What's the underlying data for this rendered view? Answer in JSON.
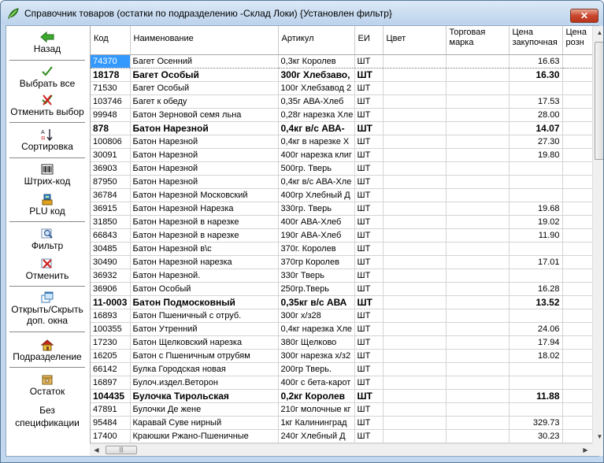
{
  "window": {
    "title": "Справочник товаров (остатки по подразделению -Склад Локи) {Установлен фильтр}",
    "close_label": "✕"
  },
  "sidebar": {
    "back": "Назад",
    "select_all": "Выбрать все",
    "cancel_selection": "Отменить выбор",
    "sort": "Сортировка",
    "barcode": "Штрих-код",
    "plu": "PLU код",
    "filter": "Фильтр",
    "cancel": "Отменить",
    "toggle_windows": "Открыть/Скрыть доп. окна",
    "department": "Подразделение",
    "remainder": "Остаток",
    "no_spec": "Без спецификации"
  },
  "table": {
    "headers": [
      "Код",
      "Наименование",
      "Артикул",
      "ЕИ",
      "Цвет",
      "Торговая марка",
      "Цена закупочная",
      "Цена розн"
    ],
    "rows": [
      {
        "code": "74370",
        "name": "Багет Осенний",
        "article": "0,3кг Королев",
        "unit": "ШТ",
        "color": "",
        "brand": "",
        "price": "16.63",
        "retail": "",
        "bold": false,
        "selected": true
      },
      {
        "code": "18178",
        "name": "Багет Особый",
        "article": "300г Хлебзаво,",
        "unit": "ШТ",
        "color": "",
        "brand": "",
        "price": "16.30",
        "retail": "",
        "bold": true,
        "selected": false
      },
      {
        "code": "71530",
        "name": "Багет Особый",
        "article": "100г Хлебзавод 2",
        "unit": "ШТ",
        "color": "",
        "brand": "",
        "price": "",
        "retail": "",
        "bold": false,
        "selected": false
      },
      {
        "code": "103746",
        "name": "Багет к обеду",
        "article": "0,35г АВА-Хлеб",
        "unit": "ШТ",
        "color": "",
        "brand": "",
        "price": "17.53",
        "retail": "",
        "bold": false,
        "selected": false
      },
      {
        "code": "99948",
        "name": "Батон Зерновой семя льна",
        "article": "0,28г нарезка Хле",
        "unit": "ШТ",
        "color": "",
        "brand": "",
        "price": "28.00",
        "retail": "",
        "bold": false,
        "selected": false
      },
      {
        "code": "878",
        "name": "Батон Нарезной",
        "article": "0,4кг в/с АВА-",
        "unit": "ШТ",
        "color": "",
        "brand": "",
        "price": "14.07",
        "retail": "",
        "bold": true,
        "selected": false
      },
      {
        "code": "100806",
        "name": "Батон Нарезной",
        "article": "0,4кг в нарезке Х",
        "unit": "ШТ",
        "color": "",
        "brand": "",
        "price": "27.30",
        "retail": "",
        "bold": false,
        "selected": false
      },
      {
        "code": "30091",
        "name": "Батон Нарезной",
        "article": "400г нарезка клиг",
        "unit": "ШТ",
        "color": "",
        "brand": "",
        "price": "19.80",
        "retail": "",
        "bold": false,
        "selected": false
      },
      {
        "code": "36903",
        "name": "Батон Нарезной",
        "article": "500гр. Тверь",
        "unit": "ШТ",
        "color": "",
        "brand": "",
        "price": "",
        "retail": "",
        "bold": false,
        "selected": false
      },
      {
        "code": "87950",
        "name": "Батон Нарезной",
        "article": "0,4кг в/с АВА-Хле",
        "unit": "ШТ",
        "color": "",
        "brand": "",
        "price": "",
        "retail": "",
        "bold": false,
        "selected": false
      },
      {
        "code": "36784",
        "name": "Батон Нарезной Московский",
        "article": "400гр Хлебный Д",
        "unit": "ШТ",
        "color": "",
        "brand": "",
        "price": "",
        "retail": "",
        "bold": false,
        "selected": false
      },
      {
        "code": "36915",
        "name": "Батон Нарезной Нарезка",
        "article": "330гр. Тверь",
        "unit": "ШТ",
        "color": "",
        "brand": "",
        "price": "19.68",
        "retail": "",
        "bold": false,
        "selected": false
      },
      {
        "code": "31850",
        "name": "Батон Нарезной в нарезке",
        "article": "400г АВА-Хлеб",
        "unit": "ШТ",
        "color": "",
        "brand": "",
        "price": "19.02",
        "retail": "",
        "bold": false,
        "selected": false
      },
      {
        "code": "66843",
        "name": "Батон Нарезной в нарезке",
        "article": "190г АВА-Хлеб",
        "unit": "ШТ",
        "color": "",
        "brand": "",
        "price": "11.90",
        "retail": "",
        "bold": false,
        "selected": false
      },
      {
        "code": "30485",
        "name": "Батон Нарезной в\\с",
        "article": "370г. Королев",
        "unit": "ШТ",
        "color": "",
        "brand": "",
        "price": "",
        "retail": "",
        "bold": false,
        "selected": false
      },
      {
        "code": "30490",
        "name": "Батон Нарезной нарезка",
        "article": "370гр Королев",
        "unit": "ШТ",
        "color": "",
        "brand": "",
        "price": "17.01",
        "retail": "",
        "bold": false,
        "selected": false
      },
      {
        "code": "36932",
        "name": "Батон Нарезной.",
        "article": "330г Тверь",
        "unit": "ШТ",
        "color": "",
        "brand": "",
        "price": "",
        "retail": "",
        "bold": false,
        "selected": false
      },
      {
        "code": "36906",
        "name": "Батон Особый",
        "article": "250гр.Тверь",
        "unit": "ШТ",
        "color": "",
        "brand": "",
        "price": "16.28",
        "retail": "",
        "bold": false,
        "selected": false
      },
      {
        "code": "11-0003",
        "name": "Батон Подмосковный",
        "article": "0,35кг в/с АВА",
        "unit": "ШТ",
        "color": "",
        "brand": "",
        "price": "13.52",
        "retail": "",
        "bold": true,
        "selected": false
      },
      {
        "code": "16893",
        "name": "Батон Пшеничный с отруб.",
        "article": "300г х/з28",
        "unit": "ШТ",
        "color": "",
        "brand": "",
        "price": "",
        "retail": "",
        "bold": false,
        "selected": false
      },
      {
        "code": "100355",
        "name": "Батон Утренний",
        "article": "0,4кг нарезка Хле",
        "unit": "ШТ",
        "color": "",
        "brand": "",
        "price": "24.06",
        "retail": "",
        "bold": false,
        "selected": false
      },
      {
        "code": "17230",
        "name": "Батон Щелковский нарезка",
        "article": "380г Щелково",
        "unit": "ШТ",
        "color": "",
        "brand": "",
        "price": "17.94",
        "retail": "",
        "bold": false,
        "selected": false
      },
      {
        "code": "16205",
        "name": "Батон с Пшеничным отрубям",
        "article": "300г нарезка х/з2",
        "unit": "ШТ",
        "color": "",
        "brand": "",
        "price": "18.02",
        "retail": "",
        "bold": false,
        "selected": false
      },
      {
        "code": "66142",
        "name": "Булка Городская новая",
        "article": "200гр Тверь.",
        "unit": "ШТ",
        "color": "",
        "brand": "",
        "price": "",
        "retail": "",
        "bold": false,
        "selected": false
      },
      {
        "code": "16897",
        "name": "Булоч.издел.Веторон",
        "article": "400г с бета-карот",
        "unit": "ШТ",
        "color": "",
        "brand": "",
        "price": "",
        "retail": "",
        "bold": false,
        "selected": false
      },
      {
        "code": "104435",
        "name": "Булочка Тирольская",
        "article": "0,2кг Королев",
        "unit": "ШТ",
        "color": "",
        "brand": "",
        "price": "11.88",
        "retail": "",
        "bold": true,
        "selected": false
      },
      {
        "code": "47891",
        "name": "Булочки Де жене",
        "article": "210г молочные кг",
        "unit": "ШТ",
        "color": "",
        "brand": "",
        "price": "",
        "retail": "",
        "bold": false,
        "selected": false
      },
      {
        "code": "95484",
        "name": "Каравай Суве нирный",
        "article": "1кг Калининград",
        "unit": "ШТ",
        "color": "",
        "brand": "",
        "price": "329.73",
        "retail": "",
        "bold": false,
        "selected": false
      },
      {
        "code": "17400",
        "name": "Краюшки Ржано-Пшеничные",
        "article": "240г Хлебный Д",
        "unit": "ШТ",
        "color": "",
        "brand": "",
        "price": "30.23",
        "retail": "",
        "bold": false,
        "selected": false
      }
    ]
  },
  "scroll": {
    "thumb_glyph": "|||"
  }
}
